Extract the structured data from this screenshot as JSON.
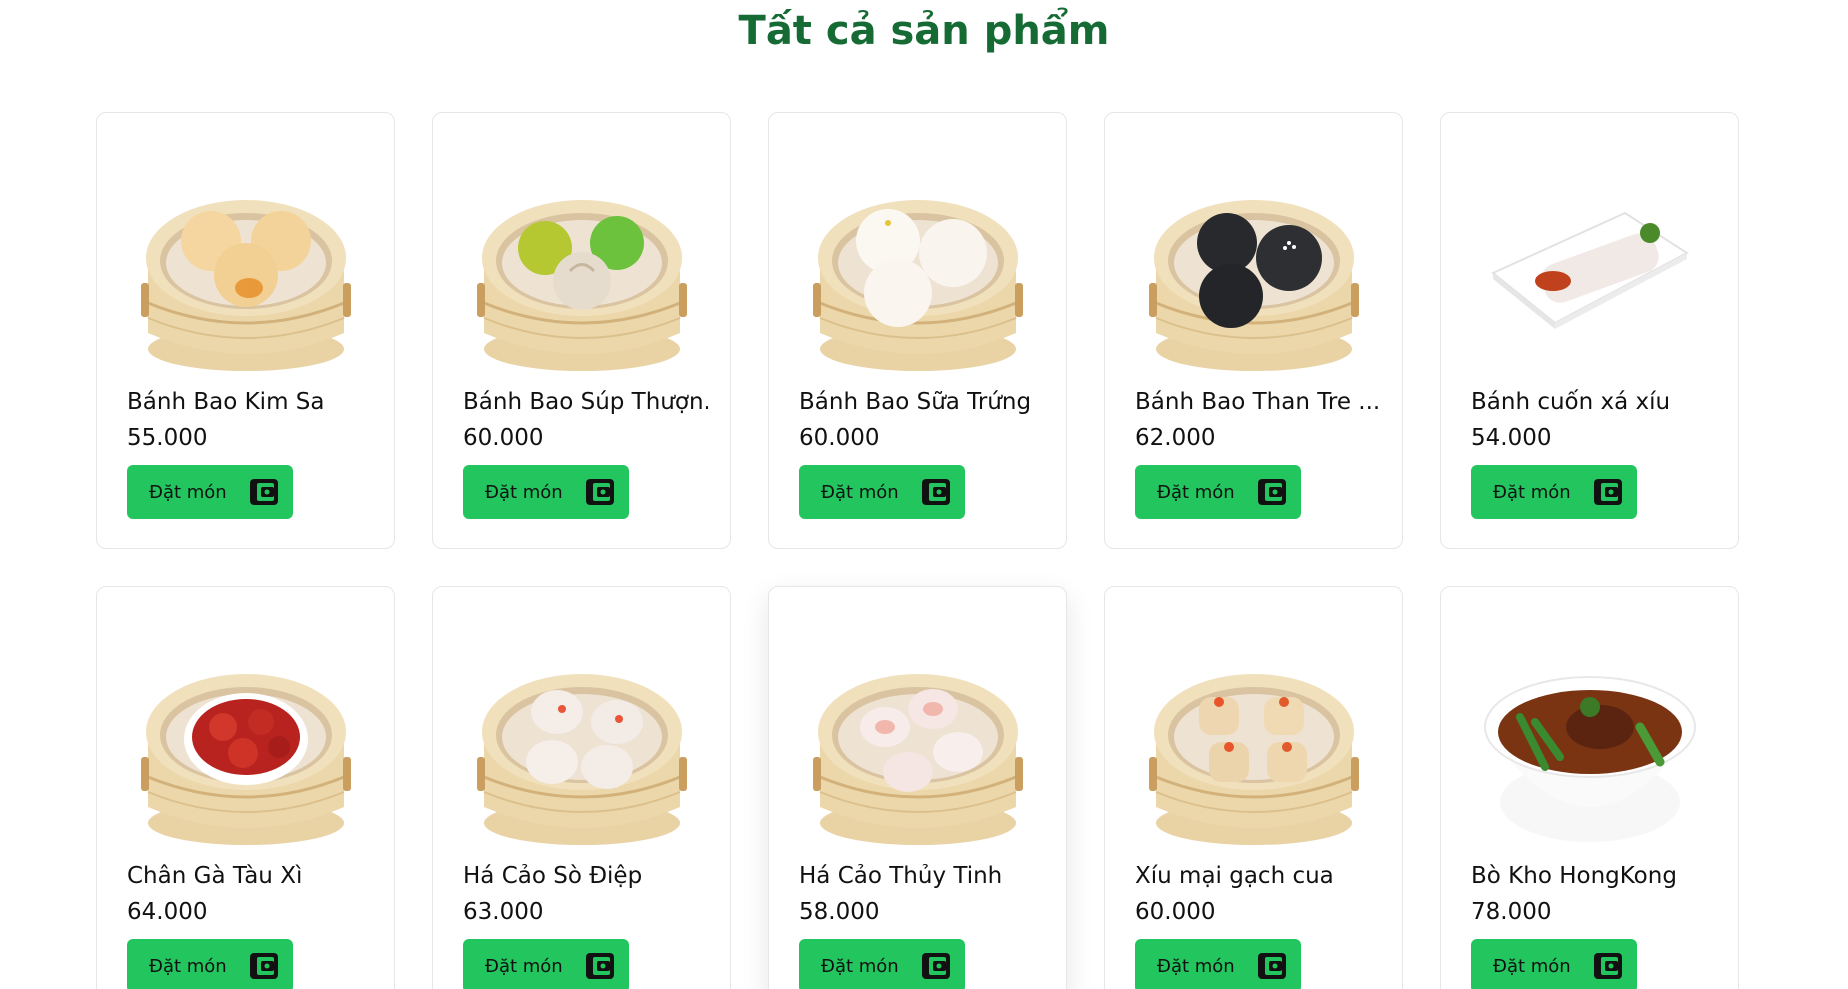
{
  "page": {
    "title": "Tất cả sản phẩm"
  },
  "colors": {
    "title": "#166b35",
    "button": "#22c55e"
  },
  "button_icon": "wallet-icon",
  "products": [
    {
      "name": "Bánh Bao Kim Sa",
      "price": "55.000",
      "button": "Đặt món",
      "image": "steamer-golden-buns"
    },
    {
      "name": "Bánh Bao Súp Thượn...",
      "price": "60.000",
      "button": "Đặt món",
      "image": "steamer-colorful-dumplings"
    },
    {
      "name": "Bánh Bao Sữa Trứng",
      "price": "60.000",
      "button": "Đặt món",
      "image": "steamer-white-buns"
    },
    {
      "name": "Bánh Bao Than Tre ...",
      "price": "62.000",
      "button": "Đặt món",
      "image": "steamer-black-buns"
    },
    {
      "name": "Bánh cuốn xá xíu",
      "price": "54.000",
      "button": "Đặt món",
      "image": "plate-rice-rolls"
    },
    {
      "name": "Chân Gà Tàu Xì",
      "price": "64.000",
      "button": "Đặt món",
      "image": "steamer-chicken-feet"
    },
    {
      "name": "Há Cảo Sò Điệp",
      "price": "63.000",
      "button": "Đặt món",
      "image": "steamer-scallop-dumplings"
    },
    {
      "name": "Há Cảo Thủy Tinh",
      "price": "58.000",
      "button": "Đặt món",
      "image": "steamer-crystal-dumplings"
    },
    {
      "name": "Xíu mại gạch cua",
      "price": "60.000",
      "button": "Đặt món",
      "image": "steamer-siu-mai"
    },
    {
      "name": "Bò Kho HongKong",
      "price": "78.000",
      "button": "Đặt món",
      "image": "bowl-beef-stew"
    }
  ]
}
